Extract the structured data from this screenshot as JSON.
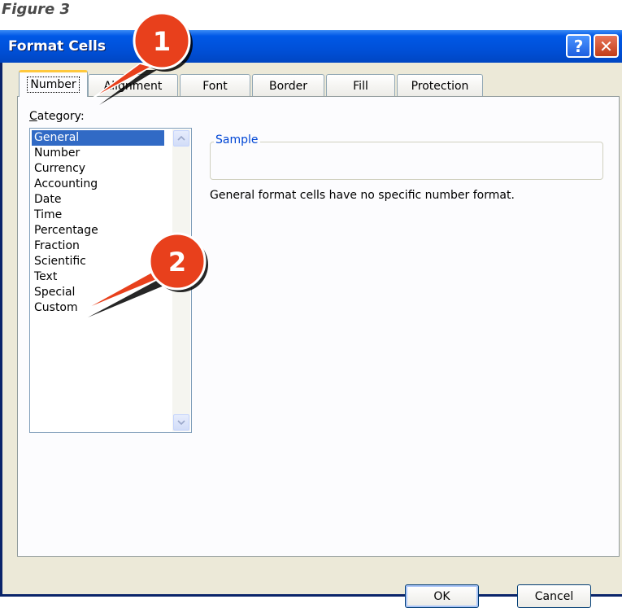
{
  "figure_caption": "Figure 3",
  "window": {
    "title": "Format Cells",
    "help_label": "?",
    "close_label": "✕"
  },
  "tabs": [
    {
      "label": "Number",
      "active": true
    },
    {
      "label": "Alignment",
      "active": false
    },
    {
      "label": "Font",
      "active": false
    },
    {
      "label": "Border",
      "active": false
    },
    {
      "label": "Fill",
      "active": false
    },
    {
      "label": "Protection",
      "active": false
    }
  ],
  "category": {
    "label_first": "C",
    "label_rest": "ategory:",
    "items": [
      "General",
      "Number",
      "Currency",
      "Accounting",
      "Date",
      "Time",
      "Percentage",
      "Fraction",
      "Scientific",
      "Text",
      "Special",
      "Custom"
    ],
    "selected": "General"
  },
  "sample": {
    "legend": "Sample",
    "value": ""
  },
  "description": "General format cells have no specific number format.",
  "buttons": {
    "ok": "OK",
    "cancel": "Cancel"
  },
  "callouts": [
    {
      "number": "1",
      "target": "Number tab"
    },
    {
      "number": "2",
      "target": "Custom category"
    }
  ],
  "colors": {
    "titlebar": "#0054e3",
    "selection": "#316ac5",
    "callout_fill": "#e8401c",
    "sample_legend": "#0046d5"
  }
}
